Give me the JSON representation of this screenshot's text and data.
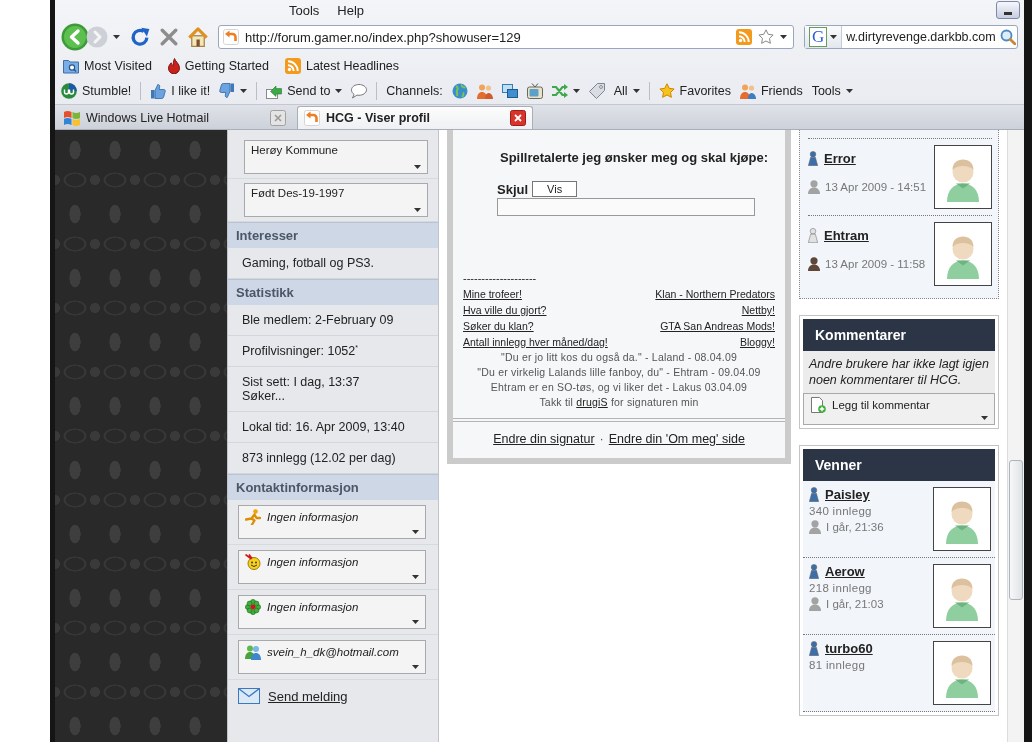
{
  "menu_bar": {
    "items": [
      "Tools",
      "Help"
    ]
  },
  "nav_bar": {
    "url": "http://forum.gamer.no/index.php?showuser=129",
    "search_engine": "G",
    "search_text": "w.dirtyrevenge.darkbb.com"
  },
  "bookmarks": [
    {
      "kind": "folder",
      "label": "Most Visited"
    },
    {
      "kind": "bookmark",
      "label": "Getting Started"
    },
    {
      "kind": "feed",
      "label": "Latest Headlines"
    }
  ],
  "addon_toolbar": [
    {
      "kind": "stumble",
      "label": "Stumble!"
    },
    {
      "kind": "separator"
    },
    {
      "kind": "like",
      "label": "I like it!"
    },
    {
      "kind": "dislike"
    },
    {
      "kind": "caret"
    },
    {
      "kind": "separator"
    },
    {
      "kind": "send",
      "label": "Send to"
    },
    {
      "kind": "caret"
    },
    {
      "kind": "comment"
    },
    {
      "kind": "separator"
    },
    {
      "kind": "label",
      "label": "Channels:"
    },
    {
      "kind": "globe"
    },
    {
      "kind": "people"
    },
    {
      "kind": "photos"
    },
    {
      "kind": "tv"
    },
    {
      "kind": "shuffle"
    },
    {
      "kind": "caret"
    },
    {
      "kind": "tag"
    },
    {
      "kind": "menu",
      "label": "All"
    },
    {
      "kind": "caret"
    },
    {
      "kind": "separator"
    },
    {
      "kind": "favorites",
      "label": "Favorites"
    },
    {
      "kind": "friends",
      "label": "Friends"
    },
    {
      "kind": "menu",
      "label": "Tools"
    },
    {
      "kind": "caret"
    }
  ],
  "tabs": [
    {
      "kind": "mail",
      "label": "Windows Live Hotmail",
      "selected": false
    },
    {
      "kind": "site",
      "label": "HCG - Viser profil",
      "selected": true
    }
  ],
  "profile": {
    "selects": [
      "Herøy Kommune",
      "Født Des-19-1997"
    ],
    "sections": [
      {
        "title": "Interesser",
        "rows": [
          {
            "text": "Gaming, fotball og PS3."
          }
        ]
      },
      {
        "title": "Statistikk",
        "rows": [
          {
            "text": "Ble medlem: 2-February 09"
          },
          {
            "text": "Profilvisninger: 1052$^{*}$"
          },
          {
            "text": "Sist sett: I dag, 13:37",
            "note": "Søker..."
          },
          {
            "text": "Lokal tid: 16. Apr 2009, 13:40"
          },
          {
            "text": "873 innlegg (12.02 per dag)"
          }
        ]
      }
    ],
    "contact": {
      "title": "Kontaktinformasjon",
      "items": [
        {
          "kind": "runner",
          "label": "Ingen informasjon"
        },
        {
          "kind": "smiley",
          "label": "Ingen informasjon"
        },
        {
          "kind": "flower",
          "label": "Ingen informasjon"
        },
        {
          "kind": "people",
          "label": "svein_h_dk@hotmail.com"
        }
      ],
      "message_link": "Send melding"
    }
  },
  "signature": {
    "heading": "Spillretalerte jeg ønsker meg og skal kjøpe:",
    "spoiler_label": "Skjul",
    "spoiler_button": "Vis",
    "rule": "--------------------",
    "links_left": [
      "Mine trofeer!",
      "Hva ville du gjort?",
      "Søker du klan?",
      "Antall innlegg hver måned/dag!"
    ],
    "links_right": [
      "Klan - Northern Predators",
      "Nettby!",
      "GTA San Andreas Mods!",
      "Bloggy!"
    ],
    "quotes": [
      "\"Du er jo litt kos du også da.\" - Laland - 08.04.09",
      "\"Du er virkelig Lalands lille fanboy, du\" - Ehtram - 09.04.09",
      "Ehtram er en SO-tøs, og vi liker det - Lakus 03.04.09"
    ],
    "thanks": {
      "before": "Takk til ",
      "link": "drugiS",
      "after": " for signaturen min"
    },
    "footer": {
      "links": [
        "Endre din signatur",
        "Endre din 'Om meg' side"
      ],
      "separator": "·"
    }
  },
  "visitors": [
    {
      "name": "Error",
      "time": "13 Apr 2009 - 14:51",
      "status_icon": {
        "color": "#3d6ea8"
      },
      "person_icon": {
        "color": "#a3a3a3"
      }
    },
    {
      "name": "Ehtram",
      "time": "13 Apr 2009 - 11:58",
      "status_icon": {
        "color": "#e2e2e2"
      },
      "person_icon": {
        "color": "#5e4638"
      }
    }
  ],
  "comments": {
    "title": "Kommentarer",
    "empty_text": "Andre brukere har ikke lagt igjen noen kommentarer til HCG.",
    "add_select": "Legg til kommentar"
  },
  "friends": {
    "title": "Venner",
    "items": [
      {
        "name": "Paisley",
        "posts": "340 innlegg",
        "last_seen": "I går, 21:36",
        "status_icon": {
          "color": "#3d6ea8"
        },
        "person_icon": {
          "color": "#a3a3a3"
        }
      },
      {
        "name": "Aerow",
        "posts": "218 innlegg",
        "last_seen": "I går, 21:03",
        "status_icon": {
          "color": "#3d6ea8"
        },
        "person_icon": {
          "color": "#a3a3a3"
        }
      },
      {
        "name": "turbo60",
        "posts": "81 innlegg",
        "status_icon": {
          "color": "#3d6ea8"
        }
      }
    ]
  }
}
